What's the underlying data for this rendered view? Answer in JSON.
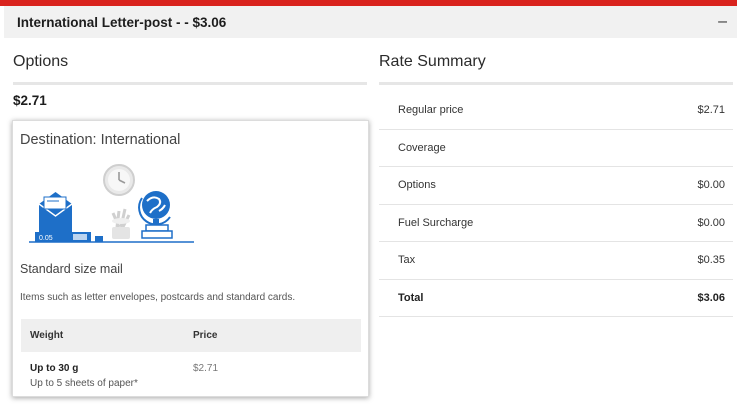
{
  "header": {
    "title": "International Letter-post - - $3.06",
    "collapse_icon": "minus-icon"
  },
  "options": {
    "title": "Options",
    "price": "$2.71",
    "card": {
      "title": "Destination: International",
      "illustration_label": "0.05",
      "subtitle": "Standard size mail",
      "description": "Items such as letter envelopes, postcards and standard cards.",
      "table": {
        "headers": [
          "Weight",
          "Price"
        ],
        "rows": [
          {
            "weight": "Up to 30 g",
            "note": "Up to 5 sheets of paper*",
            "price": "$2.71"
          }
        ]
      }
    }
  },
  "summary": {
    "title": "Rate Summary",
    "rows": [
      {
        "label": "Regular price",
        "value": "$2.71"
      },
      {
        "label": "Coverage",
        "value": ""
      },
      {
        "label": "Options",
        "value": "$0.00"
      },
      {
        "label": "Fuel Surcharge",
        "value": "$0.00"
      },
      {
        "label": "Tax",
        "value": "$0.35"
      },
      {
        "label": "Total",
        "value": "$3.06"
      }
    ]
  },
  "colors": {
    "accent": "#d9231d",
    "illustration_blue": "#1e6fc8"
  }
}
